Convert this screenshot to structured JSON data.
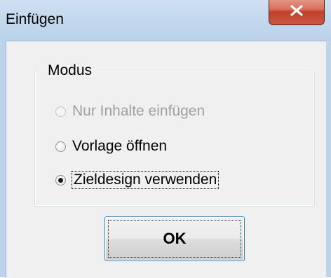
{
  "window": {
    "title": "Einfügen",
    "close_icon": "close-x-icon"
  },
  "group": {
    "legend": "Modus"
  },
  "options": [
    {
      "label": "Nur Inhalte einfügen",
      "selected": false,
      "enabled": false
    },
    {
      "label": "Vorlage öffnen",
      "selected": false,
      "enabled": true
    },
    {
      "label": "Zieldesign verwenden",
      "selected": true,
      "enabled": true
    }
  ],
  "buttons": {
    "ok_label": "OK"
  },
  "colors": {
    "titlebar": "#b9d1ea",
    "close_button": "#c0412a",
    "client_background": "#f0f0f0",
    "disabled_text": "#a0a0a0",
    "ok_border": "#3c7fb1"
  }
}
